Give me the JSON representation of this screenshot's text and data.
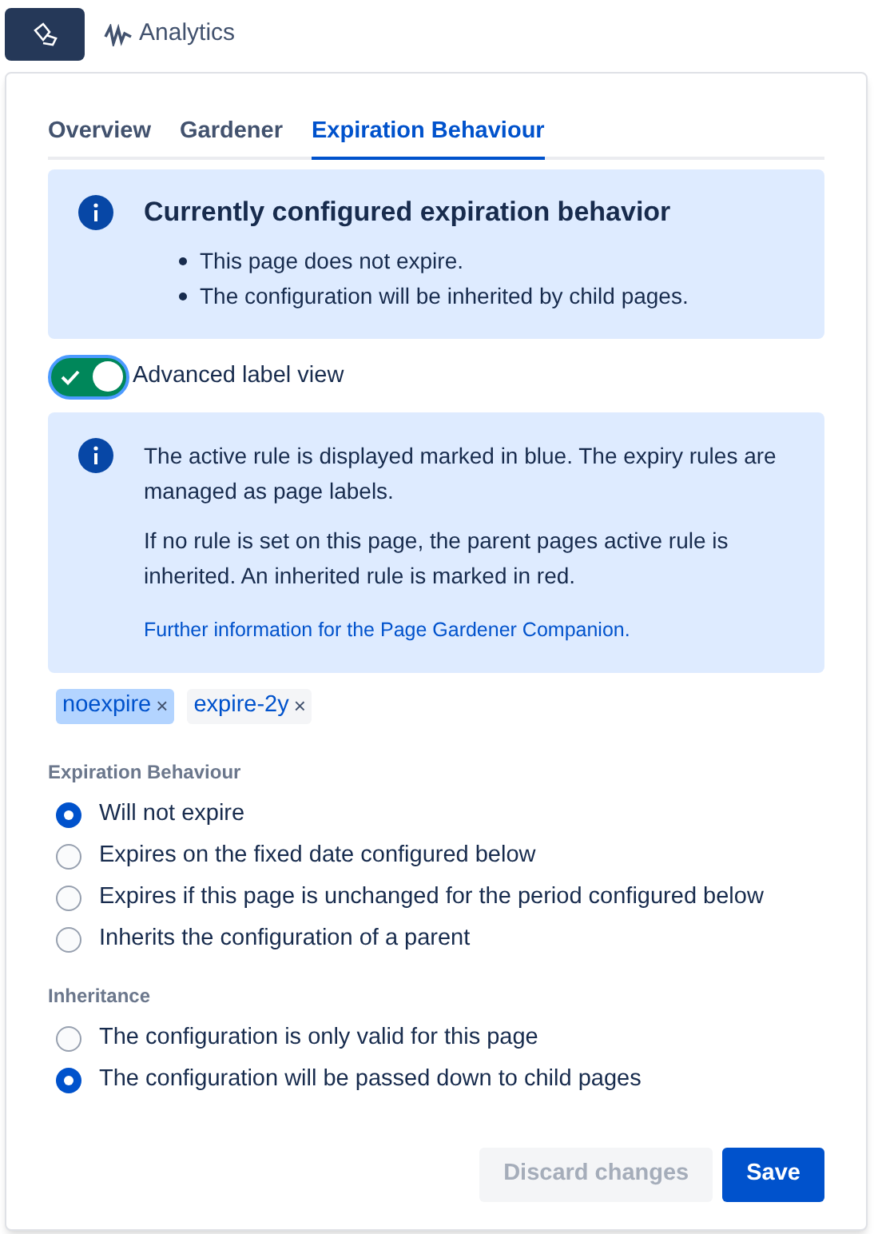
{
  "topbar": {
    "app_button": {
      "selected": true
    },
    "analytics": {
      "label": "Analytics"
    }
  },
  "tabs": [
    {
      "label": "Overview",
      "selected": false
    },
    {
      "label": "Gardener",
      "selected": false
    },
    {
      "label": "Expiration Behaviour",
      "selected": true
    }
  ],
  "current_info": {
    "title": "Currently configured expiration behavior",
    "items": [
      "This page does not expire.",
      "The configuration will be inherited by child pages."
    ]
  },
  "toggle": {
    "label": "Advanced label view",
    "on": true
  },
  "label_info": {
    "paragraphs": [
      "The active rule is displayed marked in blue. The expiry rules are managed as page labels.",
      "If no rule is set on this page, the parent pages active rule is inherited. An inherited rule is marked in red."
    ],
    "link": "Further information for the Page Gardener Companion."
  },
  "labels": [
    {
      "text": "noexpire",
      "remove": "×",
      "active": true
    },
    {
      "text": "expire-2y",
      "remove": "×",
      "active": false
    }
  ],
  "groups": [
    {
      "heading": "Expiration Behaviour",
      "options": [
        {
          "label": "Will not expire",
          "selected": true
        },
        {
          "label": "Expires on the fixed date configured below",
          "selected": false
        },
        {
          "label": "Expires if this page is unchanged for the period configured below",
          "selected": false
        },
        {
          "label": "Inherits the configuration of a parent",
          "selected": false
        }
      ]
    },
    {
      "heading": "Inheritance",
      "options": [
        {
          "label": "The configuration is only valid for this page",
          "selected": false
        },
        {
          "label": "The configuration will be passed down to child pages",
          "selected": true
        }
      ]
    }
  ],
  "buttons": [
    {
      "label": "Discard changes",
      "kind": "secondary",
      "disabled": true
    },
    {
      "label": "Save",
      "kind": "primary",
      "disabled": false
    }
  ]
}
